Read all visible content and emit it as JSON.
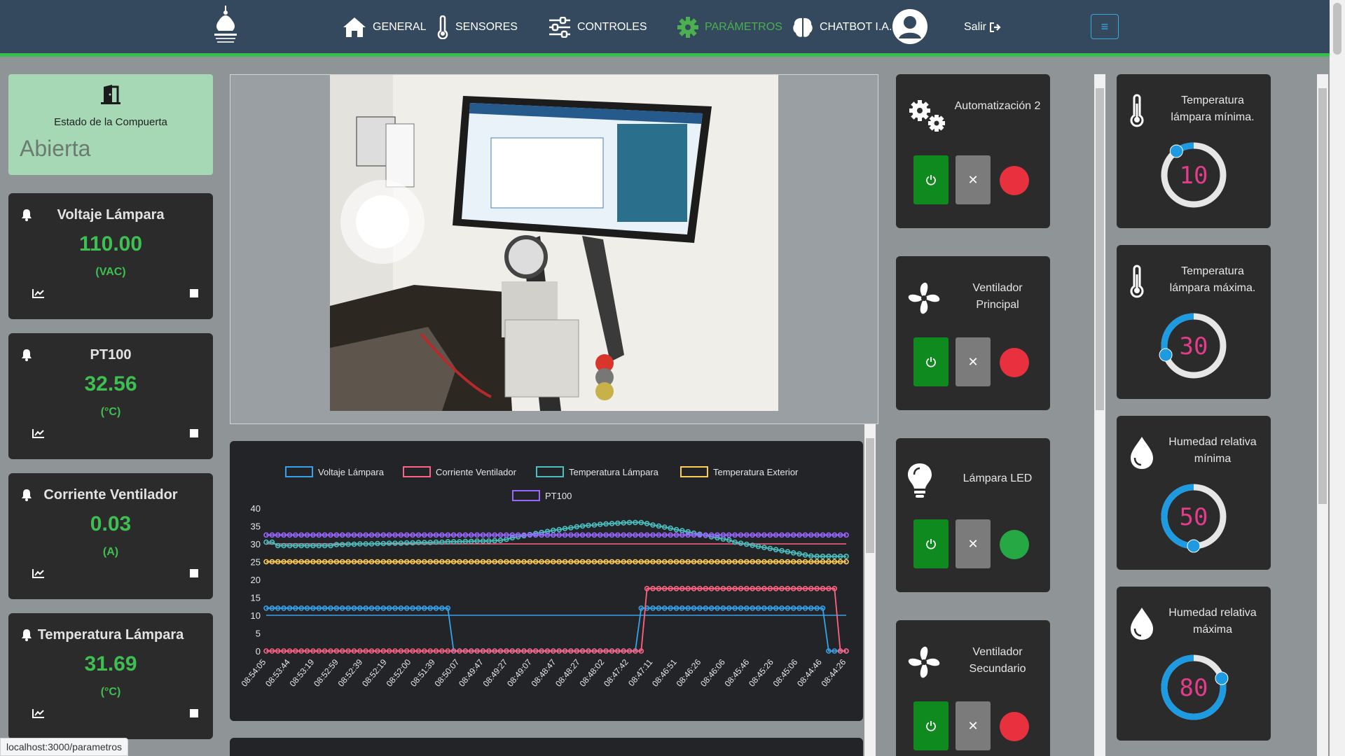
{
  "nav": {
    "items": [
      {
        "label": "GENERAL",
        "icon": "home-icon"
      },
      {
        "label": "SENSORES",
        "icon": "thermometer-icon"
      },
      {
        "label": "CONTROLES",
        "icon": "sliders-icon"
      },
      {
        "label": "PARÁMETROS",
        "icon": "gear-icon",
        "active": true
      },
      {
        "label": "CHATBOT I.A.",
        "icon": "brain-icon"
      }
    ],
    "logout_label": "Salir",
    "menu_glyph": "≡"
  },
  "gate": {
    "label": "Estado de la Compuerta",
    "value": "Abierta"
  },
  "sensors": [
    {
      "title": "Voltaje Lámpara",
      "value": "110.00",
      "unit": "(VAC)"
    },
    {
      "title": "PT100",
      "value": "32.56",
      "unit": "(°C)"
    },
    {
      "title": "Corriente Ventilador",
      "value": "0.03",
      "unit": "(A)"
    },
    {
      "title": "Temperatura Lámpara",
      "value": "31.69",
      "unit": "(°C)"
    }
  ],
  "controls": [
    {
      "title": "Automatización 2",
      "led": "#e8303f",
      "icon": "gears-icon"
    },
    {
      "title": "Ventilador Principal",
      "led": "#e8303f",
      "icon": "fan-icon"
    },
    {
      "title": "Lámpara LED",
      "led": "#26a844",
      "icon": "bulb-icon"
    },
    {
      "title": "Ventilador Secundario",
      "led": "#e8303f",
      "icon": "fan-icon"
    }
  ],
  "parameters": [
    {
      "title": "Temperatura lámpara mínima.",
      "value": "10",
      "level": 0.1,
      "icon": "thermometer-icon"
    },
    {
      "title": "Temperatura lámpara máxima.",
      "value": "30",
      "level": 0.3,
      "icon": "thermometer-icon"
    },
    {
      "title": "Humedad relativa mínima",
      "value": "50",
      "level": 0.5,
      "icon": "droplet-icon"
    },
    {
      "title": "Humedad relativa máxima",
      "value": "80",
      "level": 0.8,
      "icon": "droplet-icon"
    }
  ],
  "status_url": "localhost:3000/parametros",
  "colors": {
    "active_nav": "#4caf50",
    "value_green": "#3fbf52",
    "knob_track": "#e6e6e6",
    "knob_fill": "#1e9be0",
    "knob_text": "#e23c8a"
  },
  "chart_data": {
    "type": "line",
    "ylim": [
      0,
      40
    ],
    "yticks": [
      0,
      5,
      10,
      15,
      20,
      25,
      30,
      35,
      40
    ],
    "categories": [
      "08:54:05",
      "08:53:44",
      "08:53:19",
      "08:52:59",
      "08:52:39",
      "08:52:19",
      "08:52:00",
      "08:51:39",
      "08:50:07",
      "08:49:47",
      "08:49:27",
      "08:49:07",
      "08:48:47",
      "08:48:27",
      "08:48:02",
      "08:47:42",
      "08:47:11",
      "08:46:51",
      "08:46:26",
      "08:46:06",
      "08:45:46",
      "08:45:26",
      "08:45:06",
      "08:44:46",
      "08:44:26"
    ],
    "points_per_series": 100,
    "series": [
      {
        "name": "Voltaje Lámpara",
        "color": "#36a2eb",
        "thresh": 10,
        "segments": [
          [
            0,
            31,
            12
          ],
          [
            32,
            63,
            0
          ],
          [
            64,
            95,
            12
          ],
          [
            96,
            99,
            0
          ]
        ]
      },
      {
        "name": "Corriente Ventilador",
        "color": "#ff6384",
        "thresh": 30,
        "segments": [
          [
            0,
            64,
            0
          ],
          [
            65,
            97,
            17.5
          ],
          [
            98,
            99,
            0
          ]
        ]
      },
      {
        "name": "Temperatura Lámpara",
        "color": "#4bc0c0",
        "thresh": null,
        "curve": "temp"
      },
      {
        "name": "Temperatura Exterior",
        "color": "#ffcd56",
        "thresh": null,
        "flat": 25
      },
      {
        "name": "PT100",
        "color": "#9966ff",
        "thresh": null,
        "flat": 32.5
      }
    ]
  }
}
